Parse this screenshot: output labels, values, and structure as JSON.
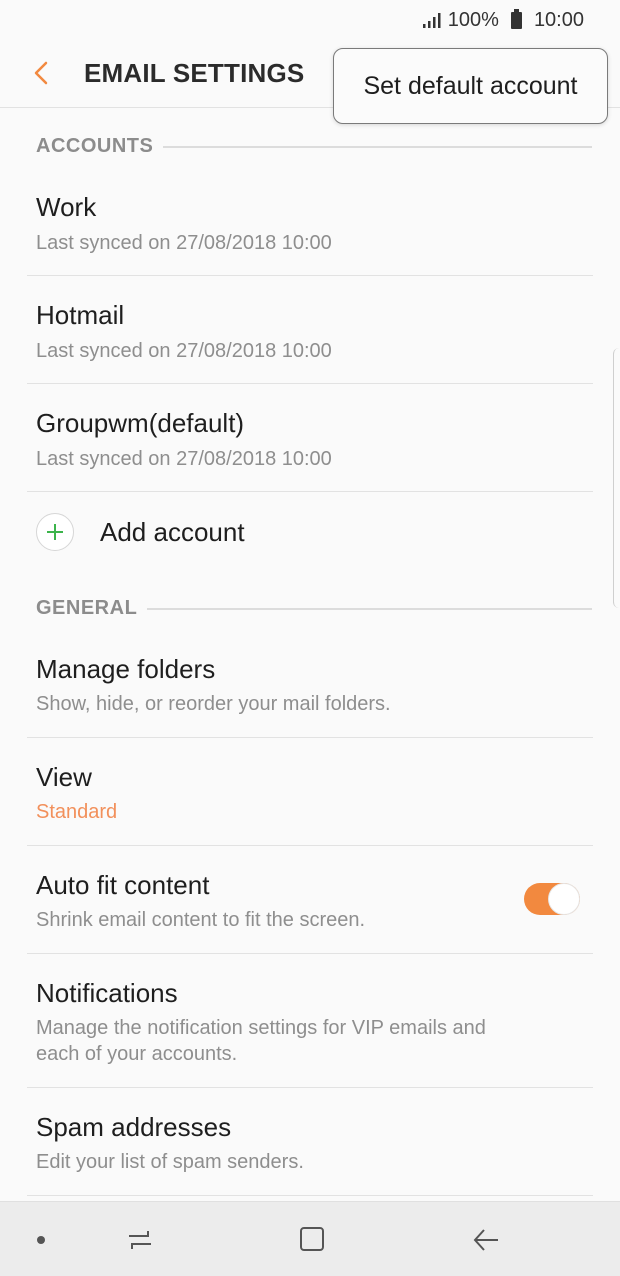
{
  "status_bar": {
    "battery": "100%",
    "time": "10:00"
  },
  "header": {
    "title": "EMAIL SETTINGS"
  },
  "popup": {
    "label": "Set default account"
  },
  "accounts_section": {
    "header": "ACCOUNTS",
    "items": [
      {
        "name": "Work",
        "sync": "Last synced on 27/08/2018  10:00"
      },
      {
        "name": "Hotmail",
        "sync": "Last synced on 27/08/2018  10:00"
      },
      {
        "name": "Groupwm(default)",
        "sync": "Last synced on 27/08/2018  10:00"
      }
    ],
    "add_label": "Add account"
  },
  "general_section": {
    "header": "GENERAL",
    "manage_folders": {
      "title": "Manage folders",
      "sub": "Show, hide, or reorder your mail folders."
    },
    "view": {
      "title": "View",
      "sub": "Standard"
    },
    "auto_fit": {
      "title": "Auto fit content",
      "sub": "Shrink email content to fit the screen.",
      "enabled": true
    },
    "notifications": {
      "title": "Notifications",
      "sub_line1": "Manage the notification settings for VIP emails and",
      "sub_line2": "each of your accounts."
    },
    "spam": {
      "title": "Spam addresses",
      "sub": "Edit your list of spam senders."
    }
  },
  "colors": {
    "accent": "#f2893f",
    "add_icon": "#3cb44b"
  }
}
